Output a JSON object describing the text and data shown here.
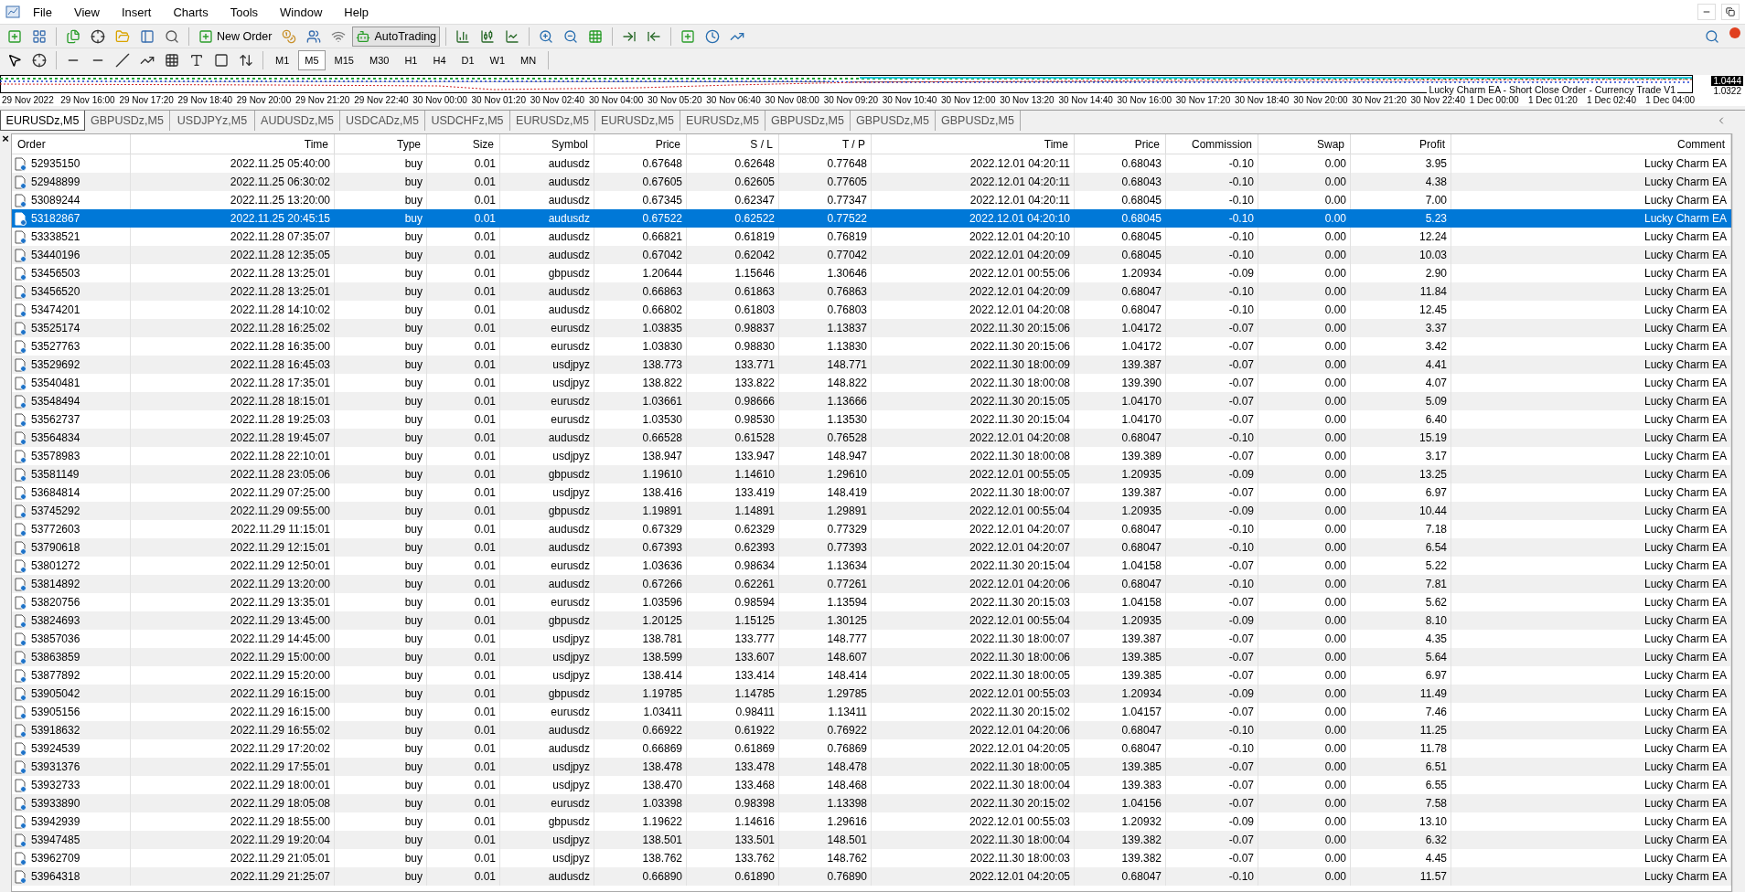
{
  "menu": [
    "File",
    "View",
    "Insert",
    "Charts",
    "Tools",
    "Window",
    "Help"
  ],
  "toolbar": {
    "new_order": "New Order",
    "autotrading": {
      "label": "AutoTrading",
      "on": true
    }
  },
  "timeframes": [
    {
      "label": "M1",
      "selected": false
    },
    {
      "label": "M5",
      "selected": true
    },
    {
      "label": "M15",
      "selected": false
    },
    {
      "label": "M30",
      "selected": false
    },
    {
      "label": "H1",
      "selected": false
    },
    {
      "label": "H4",
      "selected": false
    },
    {
      "label": "D1",
      "selected": false
    },
    {
      "label": "W1",
      "selected": false
    },
    {
      "label": "MN",
      "selected": false
    }
  ],
  "chart_strip": {
    "price_labels": [
      "1.0444",
      "1.0322"
    ],
    "ea_label": "Lucky Charm EA - Short Close Order - Currency Trade V1",
    "time_labels": [
      "29 Nov 2022",
      "29 Nov 16:00",
      "29 Nov 17:20",
      "29 Nov 18:40",
      "29 Nov 20:00",
      "29 Nov 21:20",
      "29 Nov 22:40",
      "30 Nov 00:00",
      "30 Nov 01:20",
      "30 Nov 02:40",
      "30 Nov 04:00",
      "30 Nov 05:20",
      "30 Nov 06:40",
      "30 Nov 08:00",
      "30 Nov 09:20",
      "30 Nov 10:40",
      "30 Nov 12:00",
      "30 Nov 13:20",
      "30 Nov 14:40",
      "30 Nov 16:00",
      "30 Nov 17:20",
      "30 Nov 18:40",
      "30 Nov 20:00",
      "30 Nov 21:20",
      "30 Nov 22:40",
      "1 Dec 00:00",
      "1 Dec 01:20",
      "1 Dec 02:40",
      "1 Dec 04:00"
    ]
  },
  "tabs": [
    {
      "label": "EURUSDz,M5",
      "selected": true
    },
    {
      "label": "GBPUSDz,M5",
      "selected": false
    },
    {
      "label": "USDJPYz,M5",
      "selected": false
    },
    {
      "label": "AUDUSDz,M5",
      "selected": false
    },
    {
      "label": "USDCADz,M5",
      "selected": false
    },
    {
      "label": "USDCHFz,M5",
      "selected": false
    },
    {
      "label": "EURUSDz,M5",
      "selected": false
    },
    {
      "label": "EURUSDz,M5",
      "selected": false
    },
    {
      "label": "EURUSDz,M5",
      "selected": false
    },
    {
      "label": "GBPUSDz,M5",
      "selected": false
    },
    {
      "label": "GBPUSDz,M5",
      "selected": false
    },
    {
      "label": "GBPUSDz,M5",
      "selected": false
    }
  ],
  "terminal": {
    "close": "×"
  },
  "table": {
    "columns": [
      "Order",
      "Time",
      "Type",
      "Size",
      "Symbol",
      "Price",
      "S / L",
      "T / P",
      "Time",
      "Price",
      "Commission",
      "Swap",
      "Profit",
      "Comment"
    ],
    "rows": [
      {
        "selected": false,
        "cells": [
          "52935150",
          "2022.11.25 05:40:00",
          "buy",
          "0.01",
          "audusdz",
          "0.67648",
          "0.62648",
          "0.77648",
          "2022.12.01 04:20:11",
          "0.68043",
          "-0.10",
          "0.00",
          "3.95",
          "Lucky Charm EA"
        ]
      },
      {
        "selected": false,
        "cells": [
          "52948899",
          "2022.11.25 06:30:02",
          "buy",
          "0.01",
          "audusdz",
          "0.67605",
          "0.62605",
          "0.77605",
          "2022.12.01 04:20:11",
          "0.68043",
          "-0.10",
          "0.00",
          "4.38",
          "Lucky Charm EA"
        ]
      },
      {
        "selected": false,
        "cells": [
          "53089244",
          "2022.11.25 13:20:00",
          "buy",
          "0.01",
          "audusdz",
          "0.67345",
          "0.62347",
          "0.77347",
          "2022.12.01 04:20:11",
          "0.68045",
          "-0.10",
          "0.00",
          "7.00",
          "Lucky Charm EA"
        ]
      },
      {
        "selected": true,
        "cells": [
          "53182867",
          "2022.11.25 20:45:15",
          "buy",
          "0.01",
          "audusdz",
          "0.67522",
          "0.62522",
          "0.77522",
          "2022.12.01 04:20:10",
          "0.68045",
          "-0.10",
          "0.00",
          "5.23",
          "Lucky Charm EA"
        ]
      },
      {
        "selected": false,
        "cells": [
          "53338521",
          "2022.11.28 07:35:07",
          "buy",
          "0.01",
          "audusdz",
          "0.66821",
          "0.61819",
          "0.76819",
          "2022.12.01 04:20:10",
          "0.68045",
          "-0.10",
          "0.00",
          "12.24",
          "Lucky Charm EA"
        ]
      },
      {
        "selected": false,
        "cells": [
          "53440196",
          "2022.11.28 12:35:05",
          "buy",
          "0.01",
          "audusdz",
          "0.67042",
          "0.62042",
          "0.77042",
          "2022.12.01 04:20:09",
          "0.68045",
          "-0.10",
          "0.00",
          "10.03",
          "Lucky Charm EA"
        ]
      },
      {
        "selected": false,
        "cells": [
          "53456503",
          "2022.11.28 13:25:01",
          "buy",
          "0.01",
          "gbpusdz",
          "1.20644",
          "1.15646",
          "1.30646",
          "2022.12.01 00:55:06",
          "1.20934",
          "-0.09",
          "0.00",
          "2.90",
          "Lucky Charm EA"
        ]
      },
      {
        "selected": false,
        "cells": [
          "53456520",
          "2022.11.28 13:25:01",
          "buy",
          "0.01",
          "audusdz",
          "0.66863",
          "0.61863",
          "0.76863",
          "2022.12.01 04:20:09",
          "0.68047",
          "-0.10",
          "0.00",
          "11.84",
          "Lucky Charm EA"
        ]
      },
      {
        "selected": false,
        "cells": [
          "53474201",
          "2022.11.28 14:10:02",
          "buy",
          "0.01",
          "audusdz",
          "0.66802",
          "0.61803",
          "0.76803",
          "2022.12.01 04:20:08",
          "0.68047",
          "-0.10",
          "0.00",
          "12.45",
          "Lucky Charm EA"
        ]
      },
      {
        "selected": false,
        "cells": [
          "53525174",
          "2022.11.28 16:25:02",
          "buy",
          "0.01",
          "eurusdz",
          "1.03835",
          "0.98837",
          "1.13837",
          "2022.11.30 20:15:06",
          "1.04172",
          "-0.07",
          "0.00",
          "3.37",
          "Lucky Charm EA"
        ]
      },
      {
        "selected": false,
        "cells": [
          "53527763",
          "2022.11.28 16:35:00",
          "buy",
          "0.01",
          "eurusdz",
          "1.03830",
          "0.98830",
          "1.13830",
          "2022.11.30 20:15:06",
          "1.04172",
          "-0.07",
          "0.00",
          "3.42",
          "Lucky Charm EA"
        ]
      },
      {
        "selected": false,
        "cells": [
          "53529692",
          "2022.11.28 16:45:03",
          "buy",
          "0.01",
          "usdjpyz",
          "138.773",
          "133.771",
          "148.771",
          "2022.11.30 18:00:09",
          "139.387",
          "-0.07",
          "0.00",
          "4.41",
          "Lucky Charm EA"
        ]
      },
      {
        "selected": false,
        "cells": [
          "53540481",
          "2022.11.28 17:35:01",
          "buy",
          "0.01",
          "usdjpyz",
          "138.822",
          "133.822",
          "148.822",
          "2022.11.30 18:00:08",
          "139.390",
          "-0.07",
          "0.00",
          "4.07",
          "Lucky Charm EA"
        ]
      },
      {
        "selected": false,
        "cells": [
          "53548494",
          "2022.11.28 18:15:01",
          "buy",
          "0.01",
          "eurusdz",
          "1.03661",
          "0.98666",
          "1.13666",
          "2022.11.30 20:15:05",
          "1.04170",
          "-0.07",
          "0.00",
          "5.09",
          "Lucky Charm EA"
        ]
      },
      {
        "selected": false,
        "cells": [
          "53562737",
          "2022.11.28 19:25:03",
          "buy",
          "0.01",
          "eurusdz",
          "1.03530",
          "0.98530",
          "1.13530",
          "2022.11.30 20:15:04",
          "1.04170",
          "-0.07",
          "0.00",
          "6.40",
          "Lucky Charm EA"
        ]
      },
      {
        "selected": false,
        "cells": [
          "53564834",
          "2022.11.28 19:45:07",
          "buy",
          "0.01",
          "audusdz",
          "0.66528",
          "0.61528",
          "0.76528",
          "2022.12.01 04:20:08",
          "0.68047",
          "-0.10",
          "0.00",
          "15.19",
          "Lucky Charm EA"
        ]
      },
      {
        "selected": false,
        "cells": [
          "53578983",
          "2022.11.28 22:10:01",
          "buy",
          "0.01",
          "usdjpyz",
          "138.947",
          "133.947",
          "148.947",
          "2022.11.30 18:00:08",
          "139.389",
          "-0.07",
          "0.00",
          "3.17",
          "Lucky Charm EA"
        ]
      },
      {
        "selected": false,
        "cells": [
          "53581149",
          "2022.11.28 23:05:06",
          "buy",
          "0.01",
          "gbpusdz",
          "1.19610",
          "1.14610",
          "1.29610",
          "2022.12.01 00:55:05",
          "1.20935",
          "-0.09",
          "0.00",
          "13.25",
          "Lucky Charm EA"
        ]
      },
      {
        "selected": false,
        "cells": [
          "53684814",
          "2022.11.29 07:25:00",
          "buy",
          "0.01",
          "usdjpyz",
          "138.416",
          "133.419",
          "148.419",
          "2022.11.30 18:00:07",
          "139.387",
          "-0.07",
          "0.00",
          "6.97",
          "Lucky Charm EA"
        ]
      },
      {
        "selected": false,
        "cells": [
          "53745292",
          "2022.11.29 09:55:00",
          "buy",
          "0.01",
          "gbpusdz",
          "1.19891",
          "1.14891",
          "1.29891",
          "2022.12.01 00:55:04",
          "1.20935",
          "-0.09",
          "0.00",
          "10.44",
          "Lucky Charm EA"
        ]
      },
      {
        "selected": false,
        "cells": [
          "53772603",
          "2022.11.29 11:15:01",
          "buy",
          "0.01",
          "audusdz",
          "0.67329",
          "0.62329",
          "0.77329",
          "2022.12.01 04:20:07",
          "0.68047",
          "-0.10",
          "0.00",
          "7.18",
          "Lucky Charm EA"
        ]
      },
      {
        "selected": false,
        "cells": [
          "53790618",
          "2022.11.29 12:15:01",
          "buy",
          "0.01",
          "audusdz",
          "0.67393",
          "0.62393",
          "0.77393",
          "2022.12.01 04:20:07",
          "0.68047",
          "-0.10",
          "0.00",
          "6.54",
          "Lucky Charm EA"
        ]
      },
      {
        "selected": false,
        "cells": [
          "53801272",
          "2022.11.29 12:50:01",
          "buy",
          "0.01",
          "eurusdz",
          "1.03636",
          "0.98634",
          "1.13634",
          "2022.11.30 20:15:04",
          "1.04158",
          "-0.07",
          "0.00",
          "5.22",
          "Lucky Charm EA"
        ]
      },
      {
        "selected": false,
        "cells": [
          "53814892",
          "2022.11.29 13:20:00",
          "buy",
          "0.01",
          "audusdz",
          "0.67266",
          "0.62261",
          "0.77261",
          "2022.12.01 04:20:06",
          "0.68047",
          "-0.10",
          "0.00",
          "7.81",
          "Lucky Charm EA"
        ]
      },
      {
        "selected": false,
        "cells": [
          "53820756",
          "2022.11.29 13:35:01",
          "buy",
          "0.01",
          "eurusdz",
          "1.03596",
          "0.98594",
          "1.13594",
          "2022.11.30 20:15:03",
          "1.04158",
          "-0.07",
          "0.00",
          "5.62",
          "Lucky Charm EA"
        ]
      },
      {
        "selected": false,
        "cells": [
          "53824693",
          "2022.11.29 13:45:00",
          "buy",
          "0.01",
          "gbpusdz",
          "1.20125",
          "1.15125",
          "1.30125",
          "2022.12.01 00:55:04",
          "1.20935",
          "-0.09",
          "0.00",
          "8.10",
          "Lucky Charm EA"
        ]
      },
      {
        "selected": false,
        "cells": [
          "53857036",
          "2022.11.29 14:45:00",
          "buy",
          "0.01",
          "usdjpyz",
          "138.781",
          "133.777",
          "148.777",
          "2022.11.30 18:00:07",
          "139.387",
          "-0.07",
          "0.00",
          "4.35",
          "Lucky Charm EA"
        ]
      },
      {
        "selected": false,
        "cells": [
          "53863859",
          "2022.11.29 15:00:00",
          "buy",
          "0.01",
          "usdjpyz",
          "138.599",
          "133.607",
          "148.607",
          "2022.11.30 18:00:06",
          "139.385",
          "-0.07",
          "0.00",
          "5.64",
          "Lucky Charm EA"
        ]
      },
      {
        "selected": false,
        "cells": [
          "53877892",
          "2022.11.29 15:20:00",
          "buy",
          "0.01",
          "usdjpyz",
          "138.414",
          "133.414",
          "148.414",
          "2022.11.30 18:00:05",
          "139.385",
          "-0.07",
          "0.00",
          "6.97",
          "Lucky Charm EA"
        ]
      },
      {
        "selected": false,
        "cells": [
          "53905042",
          "2022.11.29 16:15:00",
          "buy",
          "0.01",
          "gbpusdz",
          "1.19785",
          "1.14785",
          "1.29785",
          "2022.12.01 00:55:03",
          "1.20934",
          "-0.09",
          "0.00",
          "11.49",
          "Lucky Charm EA"
        ]
      },
      {
        "selected": false,
        "cells": [
          "53905156",
          "2022.11.29 16:15:00",
          "buy",
          "0.01",
          "eurusdz",
          "1.03411",
          "0.98411",
          "1.13411",
          "2022.11.30 20:15:02",
          "1.04157",
          "-0.07",
          "0.00",
          "7.46",
          "Lucky Charm EA"
        ]
      },
      {
        "selected": false,
        "cells": [
          "53918632",
          "2022.11.29 16:55:02",
          "buy",
          "0.01",
          "audusdz",
          "0.66922",
          "0.61922",
          "0.76922",
          "2022.12.01 04:20:06",
          "0.68047",
          "-0.10",
          "0.00",
          "11.25",
          "Lucky Charm EA"
        ]
      },
      {
        "selected": false,
        "cells": [
          "53924539",
          "2022.11.29 17:20:02",
          "buy",
          "0.01",
          "audusdz",
          "0.66869",
          "0.61869",
          "0.76869",
          "2022.12.01 04:20:05",
          "0.68047",
          "-0.10",
          "0.00",
          "11.78",
          "Lucky Charm EA"
        ]
      },
      {
        "selected": false,
        "cells": [
          "53931376",
          "2022.11.29 17:55:01",
          "buy",
          "0.01",
          "usdjpyz",
          "138.478",
          "133.478",
          "148.478",
          "2022.11.30 18:00:05",
          "139.385",
          "-0.07",
          "0.00",
          "6.51",
          "Lucky Charm EA"
        ]
      },
      {
        "selected": false,
        "cells": [
          "53932733",
          "2022.11.29 18:00:01",
          "buy",
          "0.01",
          "usdjpyz",
          "138.470",
          "133.468",
          "148.468",
          "2022.11.30 18:00:04",
          "139.383",
          "-0.07",
          "0.00",
          "6.55",
          "Lucky Charm EA"
        ]
      },
      {
        "selected": false,
        "cells": [
          "53933890",
          "2022.11.29 18:05:08",
          "buy",
          "0.01",
          "eurusdz",
          "1.03398",
          "0.98398",
          "1.13398",
          "2022.11.30 20:15:02",
          "1.04156",
          "-0.07",
          "0.00",
          "7.58",
          "Lucky Charm EA"
        ]
      },
      {
        "selected": false,
        "cells": [
          "53942939",
          "2022.11.29 18:55:00",
          "buy",
          "0.01",
          "gbpusdz",
          "1.19622",
          "1.14616",
          "1.29616",
          "2022.12.01 00:55:03",
          "1.20932",
          "-0.09",
          "0.00",
          "13.10",
          "Lucky Charm EA"
        ]
      },
      {
        "selected": false,
        "cells": [
          "53947485",
          "2022.11.29 19:20:04",
          "buy",
          "0.01",
          "usdjpyz",
          "138.501",
          "133.501",
          "148.501",
          "2022.11.30 18:00:04",
          "139.382",
          "-0.07",
          "0.00",
          "6.32",
          "Lucky Charm EA"
        ]
      },
      {
        "selected": false,
        "cells": [
          "53962709",
          "2022.11.29 21:05:01",
          "buy",
          "0.01",
          "usdjpyz",
          "138.762",
          "133.762",
          "148.762",
          "2022.11.30 18:00:03",
          "139.382",
          "-0.07",
          "0.00",
          "4.45",
          "Lucky Charm EA"
        ]
      },
      {
        "selected": false,
        "cells": [
          "53964318",
          "2022.11.29 21:25:07",
          "buy",
          "0.01",
          "audusdz",
          "0.66890",
          "0.61890",
          "0.76890",
          "2022.12.01 04:20:05",
          "0.68047",
          "-0.10",
          "0.00",
          "11.57",
          "Lucky Charm EA"
        ]
      }
    ]
  }
}
